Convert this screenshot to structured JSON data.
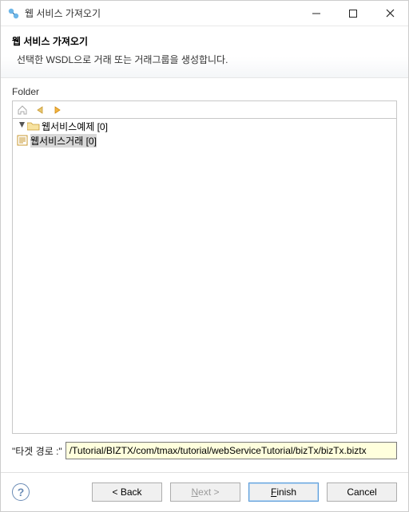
{
  "window": {
    "title": "웹 서비스 가져오기"
  },
  "banner": {
    "heading": "웹 서비스 가져오기",
    "subtext": "선택한 WSDL으로 거래 또는 거래그룹을 생성합니다."
  },
  "folder": {
    "label": "Folder",
    "tree": {
      "root_label": "웹서비스예제 [0]",
      "child_label": "웹서비스거래 [0]"
    }
  },
  "target": {
    "label": "\"타겟 경로 :\"",
    "value": "/Tutorial/BIZTX/com/tmax/tutorial/webServiceTutorial/bizTx/bizTx.biztx"
  },
  "buttons": {
    "back": "< Back",
    "next_prefix": "N",
    "next_rest": "ext >",
    "finish_prefix": "F",
    "finish_rest": "inish",
    "cancel": "Cancel"
  }
}
